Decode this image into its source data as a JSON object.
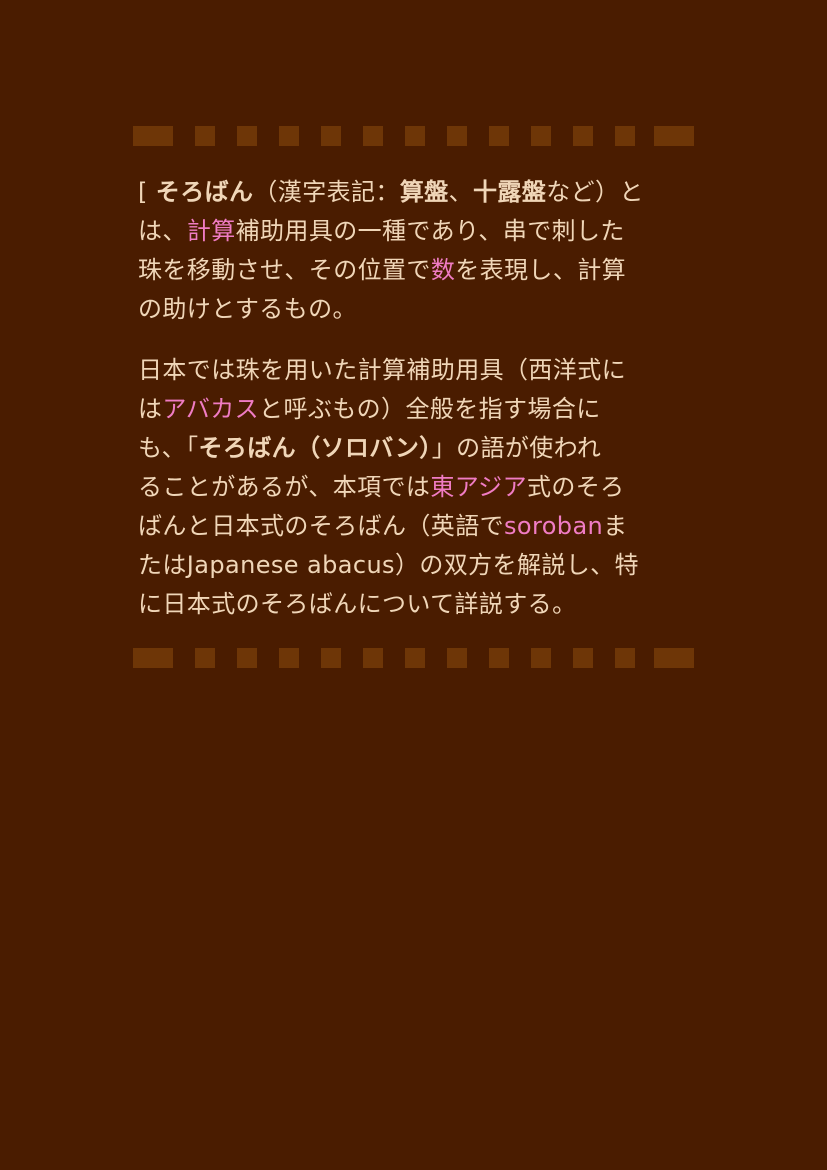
{
  "colors": {
    "background": "#4a1c00",
    "text": "#f0d6b8",
    "link": "#f07cc4",
    "divider": "#6e3607"
  },
  "paragraphs": [
    {
      "lines": [
        [
          {
            "text": "[ ",
            "style": "plain"
          },
          {
            "text": "そろばん",
            "style": "bold"
          },
          {
            "text": "（漢字表記：",
            "style": "plain"
          },
          {
            "text": "算盤",
            "style": "bold"
          },
          {
            "text": "、",
            "style": "plain"
          },
          {
            "text": "十露盤",
            "style": "bold"
          },
          {
            "text": "など）と",
            "style": "plain"
          }
        ],
        [
          {
            "text": "は、",
            "style": "plain"
          },
          {
            "text": "計算",
            "style": "link"
          },
          {
            "text": "補助用具の一種であり、串で刺した",
            "style": "plain"
          }
        ],
        [
          {
            "text": "珠を移動させ、その位置で",
            "style": "plain"
          },
          {
            "text": "数",
            "style": "link"
          },
          {
            "text": "を表現し、計算",
            "style": "plain"
          }
        ],
        [
          {
            "text": "の助けとするもの。",
            "style": "plain"
          }
        ]
      ]
    },
    {
      "lines": [
        [
          {
            "text": "日本では珠を用いた計算補助用具（西洋式に",
            "style": "plain"
          }
        ],
        [
          {
            "text": "は",
            "style": "plain"
          },
          {
            "text": "アバカス",
            "style": "link"
          },
          {
            "text": "と呼ぶもの）全般を指す場合に",
            "style": "plain"
          }
        ],
        [
          {
            "text": "も、「",
            "style": "plain"
          },
          {
            "text": "そろばん（ソロバン）",
            "style": "bold"
          },
          {
            "text": "」の語が使われ",
            "style": "plain"
          }
        ],
        [
          {
            "text": "ることがあるが、本項では",
            "style": "plain"
          },
          {
            "text": "東アジア",
            "style": "link"
          },
          {
            "text": "式のそろ",
            "style": "plain"
          }
        ],
        [
          {
            "text": "ばんと日本式のそろばん（英語で",
            "style": "plain"
          },
          {
            "text": "soroban",
            "style": "link"
          },
          {
            "text": "ま",
            "style": "plain"
          }
        ],
        [
          {
            "text": "たはJapanese abacus）の双方を解説し、特",
            "style": "plain"
          }
        ],
        [
          {
            "text": "に日本式のそろばんについて詳説する。",
            "style": "plain"
          }
        ]
      ]
    }
  ]
}
